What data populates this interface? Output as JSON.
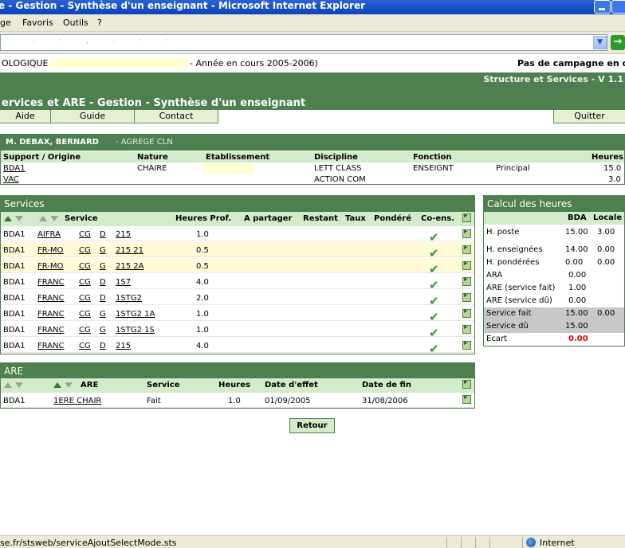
{
  "window": {
    "title": "e - Gestion - Synthèse d'un enseignant - Microsoft Internet Explorer"
  },
  "menu": [
    "ge",
    "Favoris",
    "Outils",
    "?"
  ],
  "info": {
    "left_prefix": "OLOGIQUE",
    "left_suffix": "- Année en cours 2005-2006)",
    "right": "Pas de campagne en cou"
  },
  "header": {
    "version": "Structure et Services - V 1.1",
    "page_title": "ervices et ARE - Gestion - Synthèse d'un enseignant"
  },
  "nav": {
    "aide": "Aide",
    "guide": "Guide",
    "contact": "Contact",
    "quitter": "Quitter"
  },
  "teacher": {
    "name": "M. DEBAX, BERNARD",
    "grade": "- AGREGE CLN",
    "columns": [
      "Support / Origine",
      "Nature",
      "Etablissement",
      "Discipline",
      "Fonction",
      "Heures"
    ],
    "rows": [
      {
        "support": "BDA1",
        "nature": "CHAIRE",
        "discipline": "LETT CLASS",
        "fonction": "ENSEIGNT",
        "fonction2": "Principal",
        "heures": "15.0"
      },
      {
        "support": "VAC",
        "nature": "",
        "discipline": "ACTION COM",
        "fonction": "",
        "fonction2": "",
        "heures": "3.0"
      }
    ]
  },
  "services": {
    "title": "Services",
    "columns": {
      "service": "Service",
      "heures": "Heures Prof.",
      "partager": "A partager",
      "restant": "Restant",
      "taux": "Taux",
      "ponderee": "Pondéré",
      "coens": "Co-ens."
    },
    "rows": [
      {
        "bda": "BDA1",
        "s1": "AIFRA",
        "s2": "CG",
        "s3": "D",
        "s4": "215",
        "hours": "1.0"
      },
      {
        "bda": "BDA1",
        "s1": "FR-MO",
        "s2": "CG",
        "s3": "G",
        "s4": "215  21",
        "hours": "0.5"
      },
      {
        "bda": "BDA1",
        "s1": "FR-MO",
        "s2": "CG",
        "s3": "G",
        "s4": "215  2A",
        "hours": "0.5"
      },
      {
        "bda": "BDA1",
        "s1": "FRANC",
        "s2": "CG",
        "s3": "D",
        "s4": "1S7",
        "hours": "4.0"
      },
      {
        "bda": "BDA1",
        "s1": "FRANC",
        "s2": "CG",
        "s3": "D",
        "s4": "1STG2",
        "hours": "2.0"
      },
      {
        "bda": "BDA1",
        "s1": "FRANC",
        "s2": "CG",
        "s3": "G",
        "s4": "1STG2  1A",
        "hours": "1.0"
      },
      {
        "bda": "BDA1",
        "s1": "FRANC",
        "s2": "CG",
        "s3": "G",
        "s4": "1STG2  1S",
        "hours": "1.0"
      },
      {
        "bda": "BDA1",
        "s1": "FRANC",
        "s2": "CG",
        "s3": "D",
        "s4": "215",
        "hours": "4.0"
      }
    ]
  },
  "calc": {
    "title": "Calcul des heures",
    "col_bda": "BDA",
    "col_locale": "Locale",
    "rows": [
      {
        "label": "H. poste",
        "bda": "15.00",
        "locale": "3.00"
      },
      {
        "label": "H. enseignées",
        "bda": "14.00",
        "locale": "0.00"
      },
      {
        "label": "H. pondérées",
        "bda": "0.00",
        "locale": "0.00"
      },
      {
        "label": "ARA",
        "bda": "0.00",
        "locale": ""
      },
      {
        "label": "ARE (service fait)",
        "bda": "1.00",
        "locale": ""
      },
      {
        "label": "ARE (service dû)",
        "bda": "0.00",
        "locale": ""
      },
      {
        "label": "Service fait",
        "bda": "15.00",
        "locale": "0.00"
      },
      {
        "label": "Service dû",
        "bda": "15.00",
        "locale": ""
      },
      {
        "label": "Ecart",
        "bda": "0.00",
        "locale": ""
      }
    ]
  },
  "are": {
    "title": "ARE",
    "columns": {
      "are": "ARE",
      "service": "Service",
      "heures": "Heures",
      "date_effet": "Date d'effet",
      "date_fin": "Date de fin"
    },
    "row": {
      "bda": "BDA1",
      "are": "1ERE CHAIR",
      "service": "Fait",
      "heures": "1.0",
      "date_effet": "01/09/2005",
      "date_fin": "31/08/2006"
    }
  },
  "retour_label": "Retour",
  "status": {
    "url": "se.fr/stsweb/serviceAjoutSelectMode.sts",
    "zone": "Internet"
  },
  "colors": {
    "green_dark": "#4e7f4e",
    "green_light": "#d2ebc8",
    "yellow_row": "#fffad8",
    "red": "#e00000"
  }
}
